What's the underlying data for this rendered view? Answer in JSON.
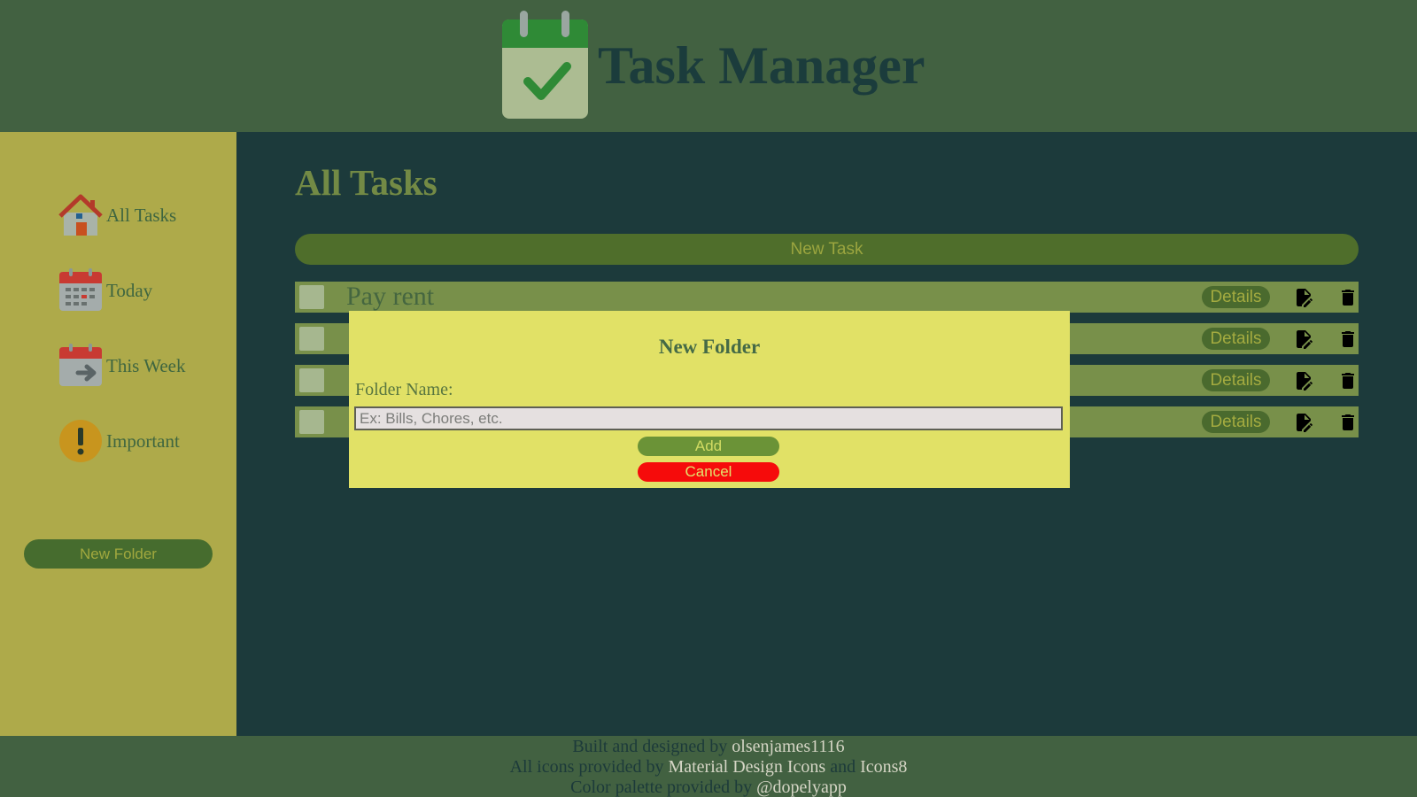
{
  "header": {
    "title": "Task Manager",
    "logo_icon": "calendar-check-icon"
  },
  "sidebar": {
    "items": [
      {
        "label": "All Tasks",
        "icon": "home-icon"
      },
      {
        "label": "Today",
        "icon": "calendar-today-icon"
      },
      {
        "label": "This Week",
        "icon": "calendar-week-icon"
      },
      {
        "label": "Important",
        "icon": "exclamation-icon"
      }
    ],
    "new_folder_label": "New Folder"
  },
  "main": {
    "title": "All Tasks",
    "new_task_label": "New Task",
    "tasks": [
      {
        "name": "Pay rent",
        "details_label": "Details"
      },
      {
        "name": "",
        "details_label": "Details"
      },
      {
        "name": "",
        "details_label": "Details"
      },
      {
        "name": "",
        "details_label": "Details"
      }
    ]
  },
  "modal": {
    "title": "New Folder",
    "field_label": "Folder Name:",
    "input_value": "",
    "input_placeholder": "Ex: Bills, Chores, etc.",
    "add_label": "Add",
    "cancel_label": "Cancel"
  },
  "footer": {
    "line1_prefix": "Built and designed by ",
    "line1_link": "olsenjames1116",
    "line2_prefix": "All icons provided by ",
    "line2_link1": "Material Design Icons",
    "line2_mid": " and ",
    "line2_link2": "Icons8",
    "line3_prefix": "Color palette provided by ",
    "line3_link": "@dopelyapp"
  },
  "colors": {
    "header_bg": "#426141",
    "sidebar_bg": "#aeaa4a",
    "main_bg": "#1c3a3b",
    "task_row_bg": "#78904a",
    "modal_bg": "#e1e166",
    "cancel_red": "#f60b0b"
  }
}
